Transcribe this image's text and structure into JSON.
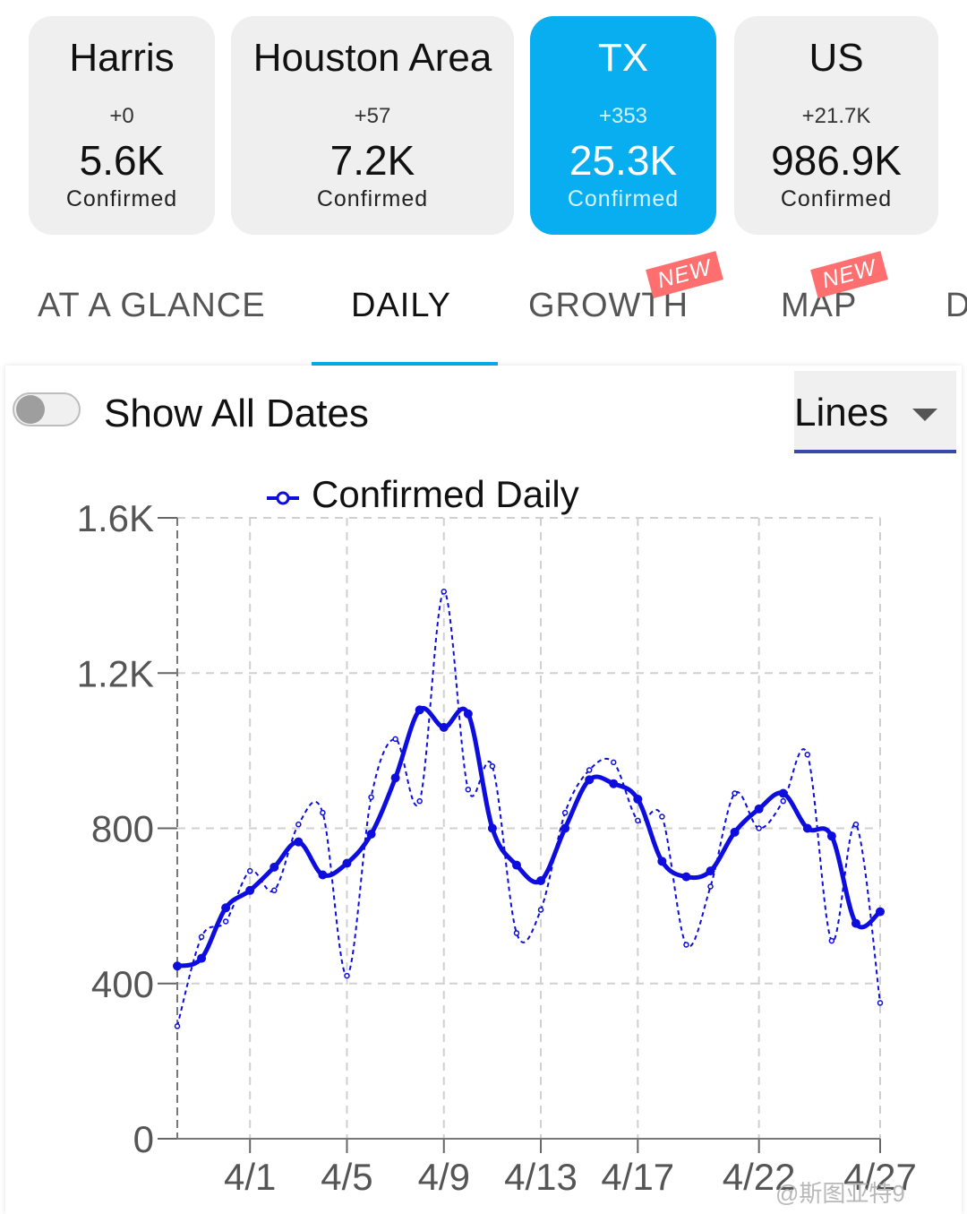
{
  "regions": [
    {
      "name": "Harris",
      "delta": "+0",
      "value": "5.6K",
      "label": "Confirmed",
      "active": false
    },
    {
      "name": "Houston Area",
      "delta": "+57",
      "value": "7.2K",
      "label": "Confirmed",
      "active": false
    },
    {
      "name": "TX",
      "delta": "+353",
      "value": "25.3K",
      "label": "Confirmed",
      "active": true
    },
    {
      "name": "US",
      "delta": "+21.7K",
      "value": "986.9K",
      "label": "Confirmed",
      "active": false
    }
  ],
  "tabs": [
    {
      "label": "AT A GLANCE",
      "active": false,
      "badge": ""
    },
    {
      "label": "DAILY",
      "active": true,
      "badge": ""
    },
    {
      "label": "GROWTH",
      "active": false,
      "badge": "NEW"
    },
    {
      "label": "MAP",
      "active": false,
      "badge": "NEW"
    },
    {
      "label": "D",
      "active": false,
      "badge": ""
    }
  ],
  "controls": {
    "show_all_dates_label": "Show All Dates",
    "show_all_dates_on": false,
    "chart_style": "Lines"
  },
  "colors": {
    "accent": "#08aef0",
    "series": "#0d0ddf",
    "badge": "#ff6f6f"
  },
  "chart_data": {
    "type": "line",
    "x": [
      "3/29",
      "3/30",
      "3/31",
      "4/1",
      "4/2",
      "4/3",
      "4/4",
      "4/5",
      "4/6",
      "4/7",
      "4/8",
      "4/9",
      "4/10",
      "4/11",
      "4/12",
      "4/13",
      "4/14",
      "4/15",
      "4/16",
      "4/17",
      "4/18",
      "4/19",
      "4/20",
      "4/21",
      "4/22",
      "4/23",
      "4/24",
      "4/25",
      "4/26",
      "4/27"
    ],
    "xtick_labels": [
      "4/1",
      "4/5",
      "4/9",
      "4/13",
      "4/17",
      "4/22",
      "4/27"
    ],
    "series": [
      {
        "name": "Confirmed Daily",
        "style": "dashed",
        "values": [
          290,
          520,
          560,
          690,
          640,
          810,
          840,
          420,
          880,
          1030,
          870,
          1410,
          900,
          960,
          530,
          590,
          840,
          950,
          970,
          820,
          830,
          500,
          650,
          890,
          800,
          870,
          990,
          510,
          810,
          350
        ]
      },
      {
        "name": "",
        "style": "solid",
        "values": [
          445,
          465,
          595,
          640,
          700,
          765,
          680,
          710,
          785,
          930,
          1105,
          1060,
          1095,
          800,
          705,
          665,
          800,
          925,
          915,
          875,
          715,
          675,
          690,
          790,
          850,
          890,
          800,
          780,
          555,
          585
        ]
      }
    ],
    "ylim": [
      0,
      1600
    ],
    "yticks": [
      0,
      400,
      800,
      1200,
      1600
    ],
    "ytick_labels": [
      "0",
      "400",
      "800",
      "1.2K",
      "1.6K"
    ],
    "grid": true,
    "legend": "top-center"
  },
  "watermark": "@斯图亚特9"
}
